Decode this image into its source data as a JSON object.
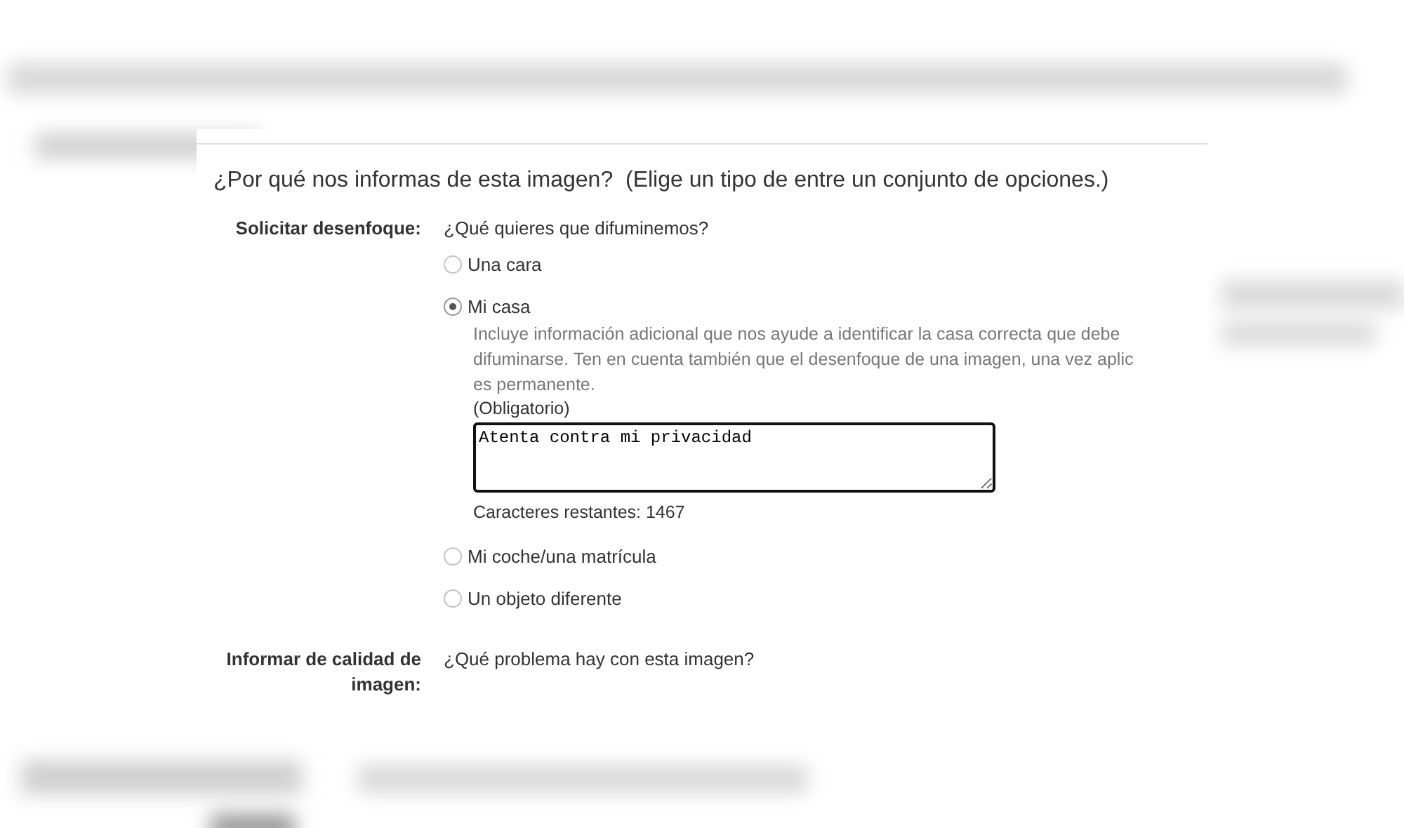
{
  "heading": "¿Por qué nos informas de esta imagen?  (Elige un tipo de entre un conjunto de opciones.)",
  "sections": [
    {
      "label": "Solicitar desenfoque:",
      "question": "¿Qué quieres que difuminemos?",
      "options": [
        {
          "label": "Una cara",
          "selected": false
        },
        {
          "label": "Mi casa",
          "selected": true,
          "details": {
            "description_lines": [
              "Incluye información adicional que nos ayude a identificar la casa correcta que debe",
              "difuminarse. Ten en cuenta también que el desenfoque de una imagen, una vez aplic",
              "es permanente."
            ],
            "required_note": "(Obligatorio)",
            "value": "Atenta contra mi privacidad",
            "remaining": "Caracteres restantes: 1467"
          }
        },
        {
          "label": "Mi coche/una matrícula",
          "selected": false
        },
        {
          "label": "Un objeto diferente",
          "selected": false
        }
      ]
    },
    {
      "label": "Informar de calidad de imagen:",
      "question": "¿Qué problema hay con esta imagen?"
    }
  ]
}
